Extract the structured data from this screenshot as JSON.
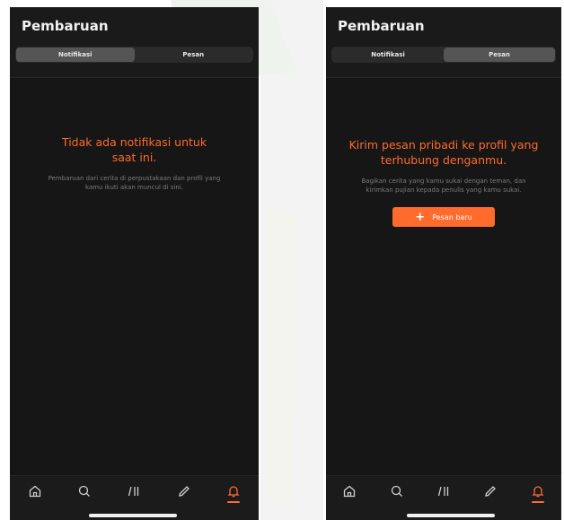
{
  "screens": [
    {
      "title": "Pembaruan",
      "tabs": [
        {
          "label": "Notifikasi",
          "active": true
        },
        {
          "label": "Pesan",
          "active": false
        }
      ],
      "empty_title": "Tidak ada notifikasi untuk saat ini.",
      "empty_subtitle": "Pembaruan dari cerita di perpustakaan dan profil yang kamu ikuti akan muncul di sini.",
      "active_nav": "notifications"
    },
    {
      "title": "Pembaruan",
      "tabs": [
        {
          "label": "Notifikasi",
          "active": false
        },
        {
          "label": "Pesan",
          "active": true
        }
      ],
      "empty_title": "Kirim pesan pribadi ke profil yang terhubung denganmu.",
      "empty_subtitle": "Bagikan cerita yang kamu sukai dengan teman, dan kirimkan pujian kepada penulis yang kamu sukai.",
      "button_label": "Pesan baru",
      "button_icon": "plus-icon",
      "active_nav": "notifications"
    }
  ],
  "bottom_nav": [
    {
      "name": "home",
      "icon": "home-icon"
    },
    {
      "name": "search",
      "icon": "search-icon"
    },
    {
      "name": "library",
      "icon": "library-icon"
    },
    {
      "name": "write",
      "icon": "pencil-icon"
    },
    {
      "name": "notifications",
      "icon": "bell-icon"
    }
  ],
  "colors": {
    "accent": "#ff6b2c",
    "background": "#161616",
    "tab_active": "#555555",
    "tab_track": "#2b2b2b"
  }
}
